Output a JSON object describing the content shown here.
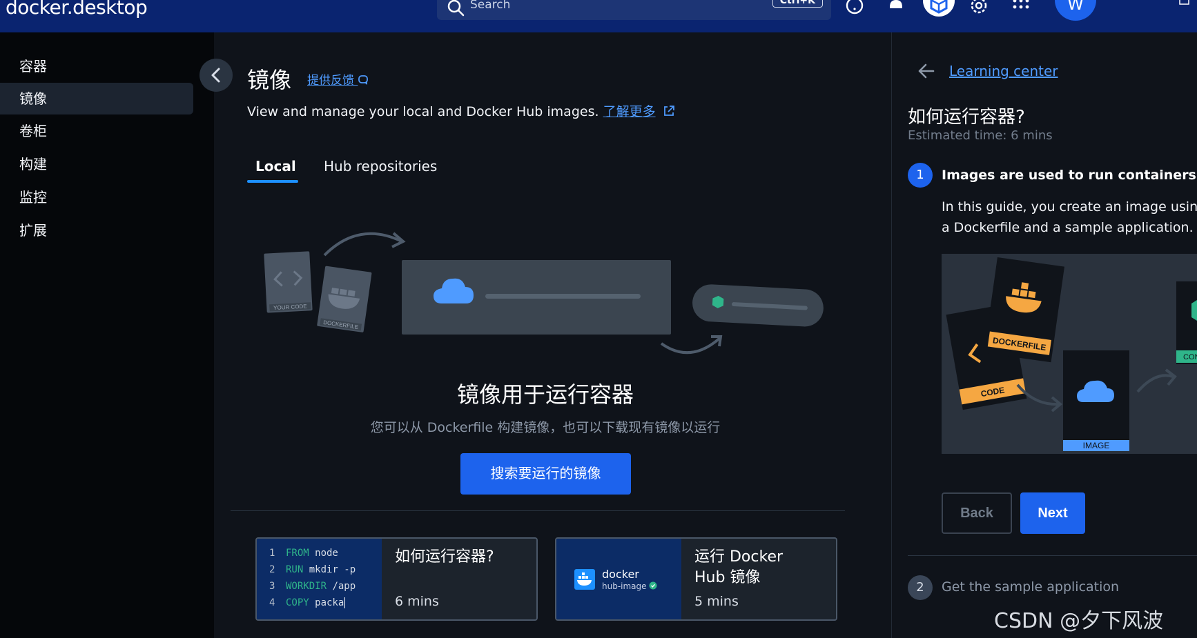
{
  "app": {
    "logo_text": "docker",
    "logo_suffix": "desktop"
  },
  "topbar": {
    "search_placeholder": "Search",
    "search_shortcut": "Ctrl+K",
    "avatar_initial": "W"
  },
  "sidebar": {
    "items": [
      {
        "label": "容器"
      },
      {
        "label": "镜像"
      },
      {
        "label": "卷柜"
      },
      {
        "label": "构建"
      },
      {
        "label": "监控"
      },
      {
        "label": "扩展"
      }
    ],
    "active_index": 1
  },
  "main": {
    "title": "镜像",
    "feedback_label": "提供反馈",
    "subtitle": "View and manage your local and Docker Hub images. ",
    "learn_more": "了解更多",
    "tabs": [
      {
        "label": "Local"
      },
      {
        "label": "Hub repositories"
      }
    ],
    "illustration": {
      "your_code": "YOUR CODE",
      "dockerfile": "DOCKERFILE"
    },
    "empty_title": "镜像用于运行容器",
    "empty_subtitle": "您可以从 Dockerfile 构建镜像，也可以下载现有镜像以运行",
    "primary_button": "搜索要运行的镜像",
    "cards": [
      {
        "title": "如何运行容器?",
        "time": "6 mins",
        "code": [
          {
            "n": "1",
            "kw": "FROM",
            "rest": " node"
          },
          {
            "n": "2",
            "kw": "RUN",
            "rest": " mkdir -p"
          },
          {
            "n": "3",
            "kw": "WORKDIR",
            "rest": " /app"
          },
          {
            "n": "4",
            "kw": "COPY",
            "rest": " packa"
          }
        ]
      },
      {
        "title_line1": "运行 Docker",
        "title_line2": "Hub 镜像",
        "time": "5 mins",
        "brand": "docker",
        "brand_sub": "hub-image"
      }
    ]
  },
  "right_panel": {
    "back_link": "Learning center",
    "title": "如何运行容器?",
    "estimated": "Estimated time: 6 mins",
    "step1": {
      "num": "1",
      "title": "Images are used to run containers",
      "body": "In this guide, you create an image using a Dockerfile and a sample application."
    },
    "illustration": {
      "dockerfile": "DOCKERFILE",
      "code": "CODE",
      "image": "IMAGE",
      "container": "CONTAINER"
    },
    "back_button": "Back",
    "next_button": "Next",
    "step2": {
      "num": "2",
      "title": "Get the sample application"
    }
  },
  "watermark": "CSDN @夕下风波",
  "colors": {
    "topbar": "#0a2470",
    "accent": "#1d63ed",
    "link": "#4f9bff",
    "tab_underline": "#1d90ff",
    "code_keyword": "#2fb58a"
  }
}
